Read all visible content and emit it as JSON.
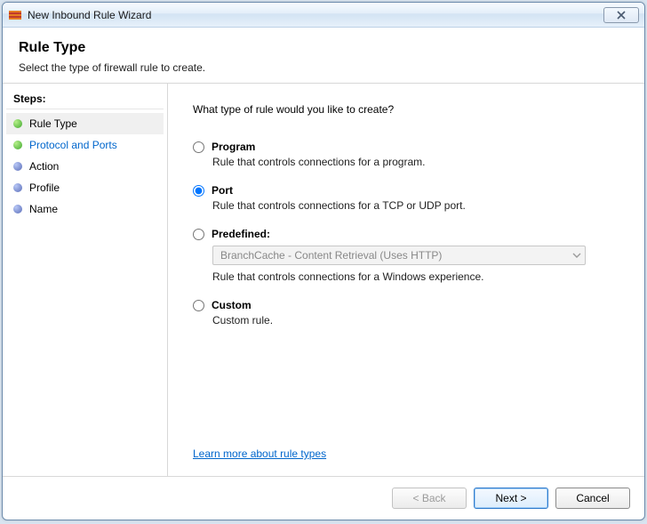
{
  "window": {
    "title": "New Inbound Rule Wizard"
  },
  "header": {
    "title": "Rule Type",
    "subtitle": "Select the type of firewall rule to create."
  },
  "sidebar": {
    "steps_label": "Steps:",
    "items": [
      {
        "label": "Rule Type"
      },
      {
        "label": "Protocol and Ports"
      },
      {
        "label": "Action"
      },
      {
        "label": "Profile"
      },
      {
        "label": "Name"
      }
    ]
  },
  "content": {
    "prompt": "What type of rule would you like to create?",
    "options": {
      "program": {
        "label": "Program",
        "desc": "Rule that controls connections for a program."
      },
      "port": {
        "label": "Port",
        "desc": "Rule that controls connections for a TCP or UDP port."
      },
      "predefined": {
        "label": "Predefined:",
        "desc": "Rule that controls connections for a Windows experience.",
        "select_value": "BranchCache - Content Retrieval (Uses HTTP)"
      },
      "custom": {
        "label": "Custom",
        "desc": "Custom rule."
      }
    },
    "learn_link": "Learn more about rule types"
  },
  "footer": {
    "back": "< Back",
    "next": "Next >",
    "cancel": "Cancel"
  }
}
